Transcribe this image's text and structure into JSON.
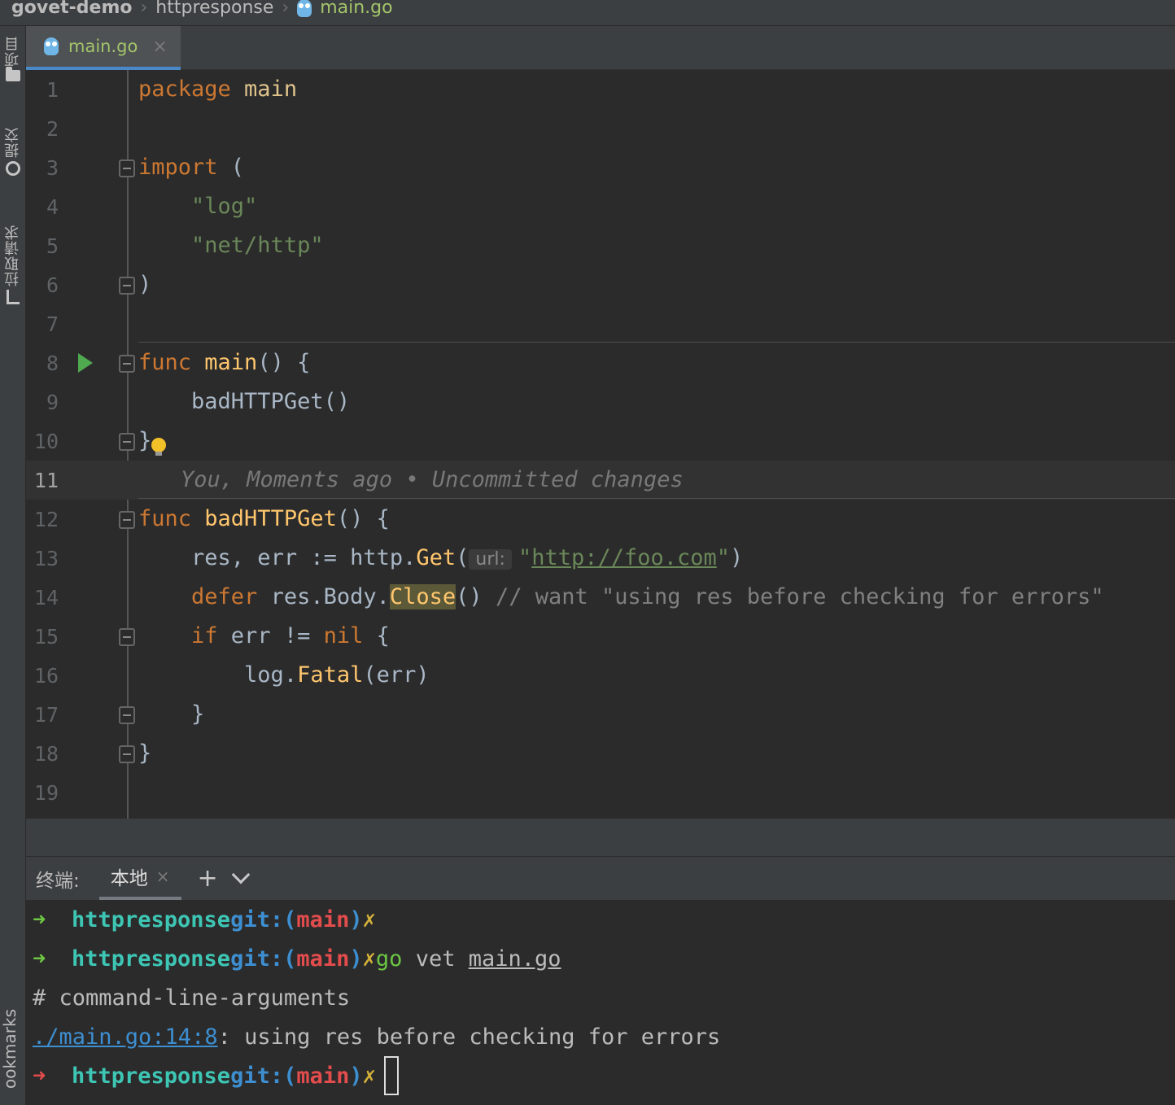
{
  "breadcrumb": {
    "project": "govet-demo",
    "folder": "httpresponse",
    "file": "main.go"
  },
  "toolstrip": {
    "project": "项目",
    "commit": "提交",
    "pull_requests": "拉取请求",
    "bookmarks": "ookmarks"
  },
  "editor_tab": {
    "label": "main.go",
    "close": "×"
  },
  "editor": {
    "line_numbers": [
      "1",
      "2",
      "3",
      "4",
      "5",
      "6",
      "7",
      "8",
      "9",
      "10",
      "11",
      "12",
      "13",
      "14",
      "15",
      "16",
      "17",
      "18",
      "19"
    ],
    "blame": "You, Moments ago • Uncommitted changes",
    "param_hint": "url:",
    "code": {
      "l1_kw": "package",
      "l1_name": " main",
      "l3_kw": "import",
      "l3_rest": " (",
      "l4": "\"log\"",
      "l5": "\"net/http\"",
      "l6": ")",
      "l8_kw": "func",
      "l8_fn": " main",
      "l8_rest": "() {",
      "l9": "badHTTPGet()",
      "l10": "}",
      "l12_kw": "func",
      "l12_fn": " badHTTPGet",
      "l12_rest": "() {",
      "l13_a": "res, err := http.",
      "l13_fn": "Get",
      "l13_b": "(",
      "l13_q1": "\"",
      "l13_url": "http://foo.com",
      "l13_q2": "\"",
      "l13_c": ")",
      "l14_kw": "defer",
      "l14_a": " res.Body.",
      "l14_hl": "Close",
      "l14_b": "() ",
      "l14_cmt": "// want \"using res before checking for errors\"",
      "l15_kw": "if",
      "l15_a": " err != ",
      "l15_nil": "nil",
      "l15_b": " {",
      "l16_a": "log.",
      "l16_fn": "Fatal",
      "l16_b": "(err)",
      "l17": "}",
      "l18": "}"
    }
  },
  "terminal": {
    "title": "终端:",
    "tab": "本地",
    "tab_close": "×",
    "add": "+",
    "arrow": "➜",
    "dir": "httpresponse",
    "git": "git:(",
    "branch": "main",
    "git_close": ")",
    "dirty": "✗",
    "cmd_go": "go",
    "cmd_vet": " vet ",
    "cmd_file": "main.go",
    "out1": "# command-line-arguments",
    "out2_path": "./main.go:14:8",
    "out2_msg": ": using res before checking for errors"
  },
  "colors": {
    "background": "#2b2b2b",
    "keyword": "#cc7832",
    "function": "#ffc66d",
    "string": "#6a8759",
    "prompt_arrow": "#6cc644",
    "prompt_dir": "#3ec6b5",
    "git_blue": "#3d8fd1",
    "branch_red": "#e34c4c"
  }
}
